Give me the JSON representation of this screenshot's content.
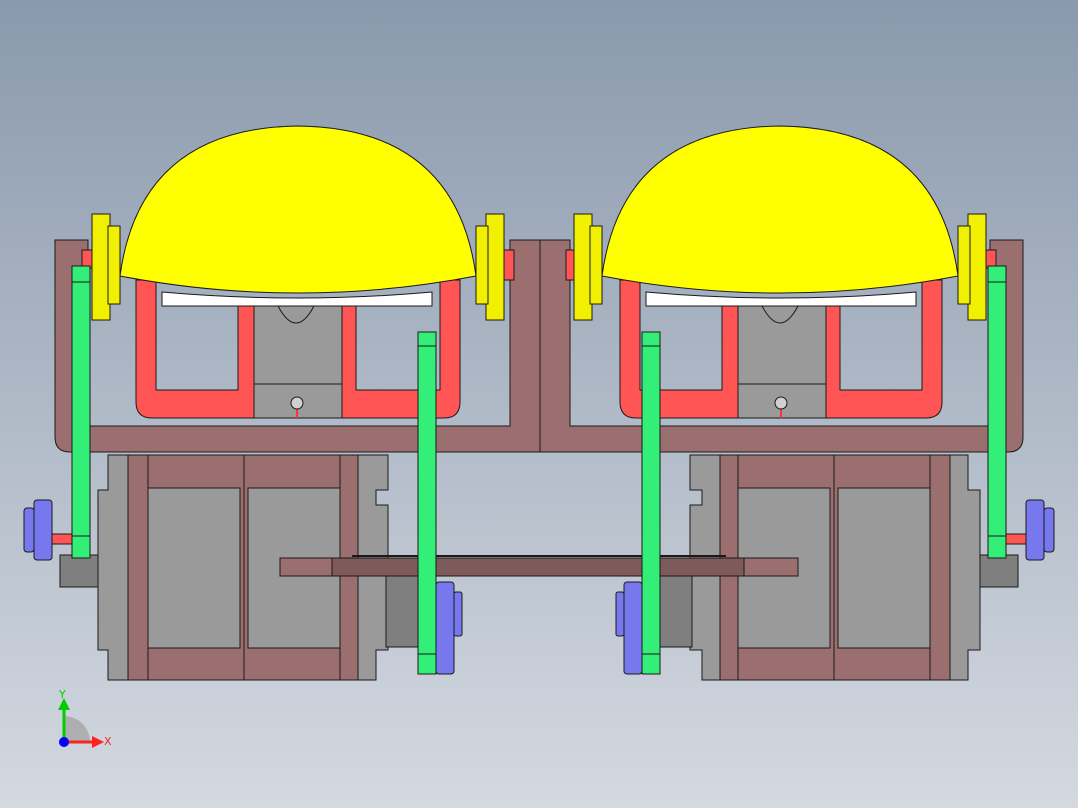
{
  "viewport": {
    "background_top": "#8a99ad",
    "background_bottom": "#d4d9e0"
  },
  "colors": {
    "dome": "#ffff00",
    "flange": "#f0f000",
    "frame": "#9b6f6f",
    "frame_dark": "#7e5a5a",
    "bracket": "#ff5555",
    "link": "#33ee77",
    "motor": "#9a9a9a",
    "motor_dark": "#7f7f7f",
    "knob": "#7777ee",
    "outline": "#1a1a1a",
    "plate": "#ffffff"
  },
  "triad": {
    "y_label": "Y",
    "x_label": "X",
    "y_color": "#00cc00",
    "x_color": "#ff2222",
    "z_color": "#0000ff"
  }
}
